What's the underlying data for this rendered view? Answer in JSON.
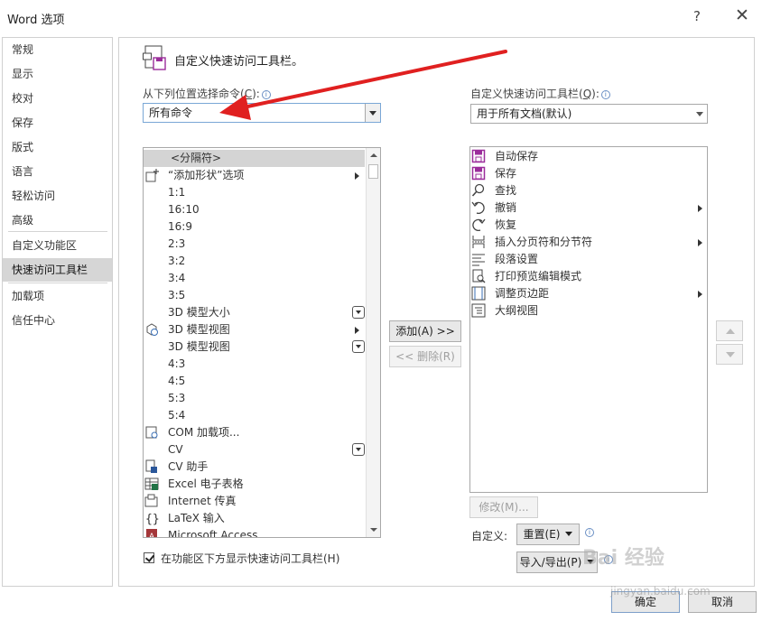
{
  "window": {
    "title": "Word 选项",
    "help_glyph": "?",
    "close_glyph": "✕"
  },
  "nav": {
    "items": [
      {
        "label": "常规"
      },
      {
        "label": "显示"
      },
      {
        "label": "校对"
      },
      {
        "label": "保存"
      },
      {
        "label": "版式"
      },
      {
        "label": "语言"
      },
      {
        "label": "轻松访问"
      },
      {
        "label": "高级"
      },
      {
        "label": "自定义功能区"
      },
      {
        "label": "快速访问工具栏",
        "selected": true
      },
      {
        "label": "加载项"
      },
      {
        "label": "信任中心"
      }
    ]
  },
  "page": {
    "heading": "自定义快速访问工具栏。",
    "choose_label": "从下列位置选择命令(",
    "choose_key": "C",
    "choose_label_end": "):",
    "choose_value": "所有命令",
    "customize_label": "自定义快速访问工具栏(",
    "customize_key": "Q",
    "customize_label_end": "):",
    "customize_value": "用于所有文档(默认)",
    "info_glyph": "i"
  },
  "commands": [
    {
      "label": "<分隔符>",
      "separator": true
    },
    {
      "label": "“添加形状”选项",
      "icon": "add-shape-icon",
      "submenu": true
    },
    {
      "label": "1:1"
    },
    {
      "label": "16:10"
    },
    {
      "label": "16:9"
    },
    {
      "label": "2:3"
    },
    {
      "label": "3:2"
    },
    {
      "label": "3:4"
    },
    {
      "label": "3:5"
    },
    {
      "label": "3D 模型大小",
      "dropdown": true
    },
    {
      "label": "3D 模型视图",
      "icon": "3d-model-icon",
      "submenu": true
    },
    {
      "label": "3D 模型视图",
      "dropdown": true
    },
    {
      "label": "4:3"
    },
    {
      "label": "4:5"
    },
    {
      "label": "5:3"
    },
    {
      "label": "5:4"
    },
    {
      "label": "COM 加载项...",
      "icon": "com-addin-icon"
    },
    {
      "label": "CV",
      "dropdown": true
    },
    {
      "label": "CV 助手",
      "icon": "cv-assistant-icon"
    },
    {
      "label": "Excel 电子表格",
      "icon": "excel-icon"
    },
    {
      "label": "Internet 传真",
      "icon": "fax-icon"
    },
    {
      "label": "LaTeX 输入",
      "icon": "braces-icon"
    },
    {
      "label": "Microsoft Access",
      "icon": "access-icon"
    }
  ],
  "toolbar_items": [
    {
      "label": "自动保存",
      "icon": "autosave-icon"
    },
    {
      "label": "保存",
      "icon": "save-icon"
    },
    {
      "label": "查找",
      "icon": "find-icon"
    },
    {
      "label": "撤销",
      "icon": "undo-icon",
      "submenu": true
    },
    {
      "label": "恢复",
      "icon": "redo-icon"
    },
    {
      "label": "插入分页符和分节符",
      "icon": "page-break-icon",
      "submenu": true
    },
    {
      "label": "段落设置",
      "icon": "paragraph-icon"
    },
    {
      "label": "打印预览编辑模式",
      "icon": "print-preview-icon"
    },
    {
      "label": "调整页边距",
      "icon": "margins-icon",
      "submenu": true
    },
    {
      "label": "大纲视图",
      "icon": "outline-icon"
    }
  ],
  "buttons": {
    "add": "添加(A) >>",
    "remove": "<< 删除(R)",
    "modify": "修改(M)...",
    "reset": "重置(E)",
    "import_export": "导入/导出(P)",
    "ok": "确定",
    "cancel": "取消"
  },
  "customize_label2": "自定义:",
  "checkbox": {
    "label": "在功能区下方显示快速访问工具栏(H)",
    "checked": true
  },
  "watermark": {
    "brand": "Bai 经验",
    "url": "jingyan.baidu.com"
  },
  "colors": {
    "accent": "#7aa7d6",
    "selected_nav": "#d6d6d6",
    "annotation_arrow": "#e02020",
    "save_icon": "#9b2d9b"
  }
}
